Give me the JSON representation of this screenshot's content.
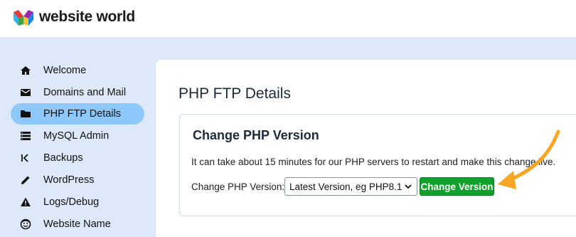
{
  "brand": {
    "name": "website world"
  },
  "sidebar": {
    "items": [
      {
        "label": "Welcome",
        "icon": "home-icon"
      },
      {
        "label": "Domains and Mail",
        "icon": "mail-icon"
      },
      {
        "label": "PHP FTP Details",
        "icon": "folder-icon",
        "active": true
      },
      {
        "label": "MySQL Admin",
        "icon": "database-icon"
      },
      {
        "label": "Backups",
        "icon": "backups-icon"
      },
      {
        "label": "WordPress",
        "icon": "pencil-icon"
      },
      {
        "label": "Logs/Debug",
        "icon": "warning-icon"
      },
      {
        "label": "Website Name",
        "icon": "smiley-icon"
      }
    ]
  },
  "main": {
    "title": "PHP FTP Details",
    "card": {
      "title": "Change PHP Version",
      "description": "It can take about 15 minutes for our PHP servers to restart and make this change live.",
      "form_label": "Change PHP Version:",
      "select_value": "Latest Version, eg PHP8.1",
      "button_label": "Change Version"
    }
  },
  "colors": {
    "active_nav": "#8ec8fb",
    "page_bg": "#dde8f9",
    "button": "#10a12c",
    "annotation_arrow": "#f6a623"
  }
}
